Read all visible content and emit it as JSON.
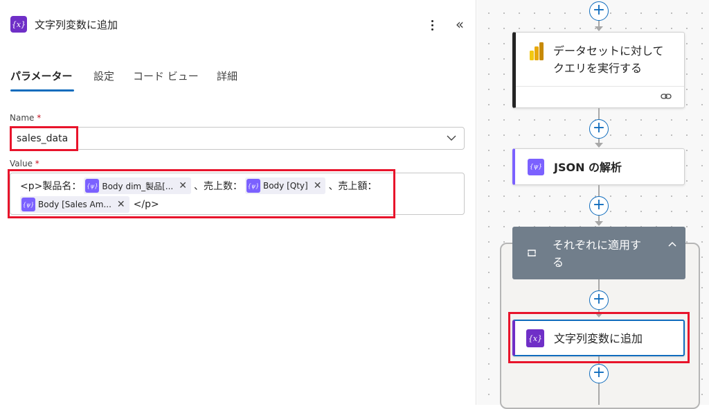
{
  "panel": {
    "title": "文字列変数に追加",
    "icon": "variable-icon",
    "icon_text": "{x}",
    "collapse_glyph": "«"
  },
  "tabs": [
    {
      "label": "パラメーター",
      "active": true
    },
    {
      "label": "設定",
      "active": false
    },
    {
      "label": "コード ビュー",
      "active": false
    },
    {
      "label": "詳細",
      "active": false
    }
  ],
  "fields": {
    "name": {
      "label": "Name",
      "required_mark": "*",
      "value": "sales_data"
    },
    "value": {
      "label": "Value",
      "required_mark": "*",
      "line1": {
        "prefix": "<p>製品名：",
        "token1": "Body dim_製品[...",
        "sep1": "、売上数：",
        "token2": "Body [Qty]",
        "sep2": "、売上額："
      },
      "line2": {
        "token3": "Body [Sales Am...",
        "suffix": "</p>"
      },
      "token_icon_text": "{ψ}",
      "token_close": "✕"
    }
  },
  "flow": {
    "plus_glyph": "+",
    "cards": {
      "dataset": {
        "line1": "データセットに対して",
        "line2": "クエリを実行する",
        "icon": "power-bi-icon",
        "footer_icon": "link-icon"
      },
      "json": {
        "label": "JSON の解析",
        "icon": "parse-json-icon",
        "icon_text": "{ψ}"
      },
      "foreach": {
        "line1": "それぞれに適用す",
        "line2": "る",
        "icon": "loop-icon",
        "chevron": "chevron-up-icon"
      },
      "append": {
        "label": "文字列変数に追加",
        "icon": "variable-icon",
        "icon_text": "{x}"
      }
    }
  },
  "colors": {
    "accent": "#0f6cbd",
    "variable_purple": "#6f2fc7",
    "token_purple": "#7b61ff",
    "highlight_red": "#e8142b",
    "foreach_header": "#717e8b"
  }
}
